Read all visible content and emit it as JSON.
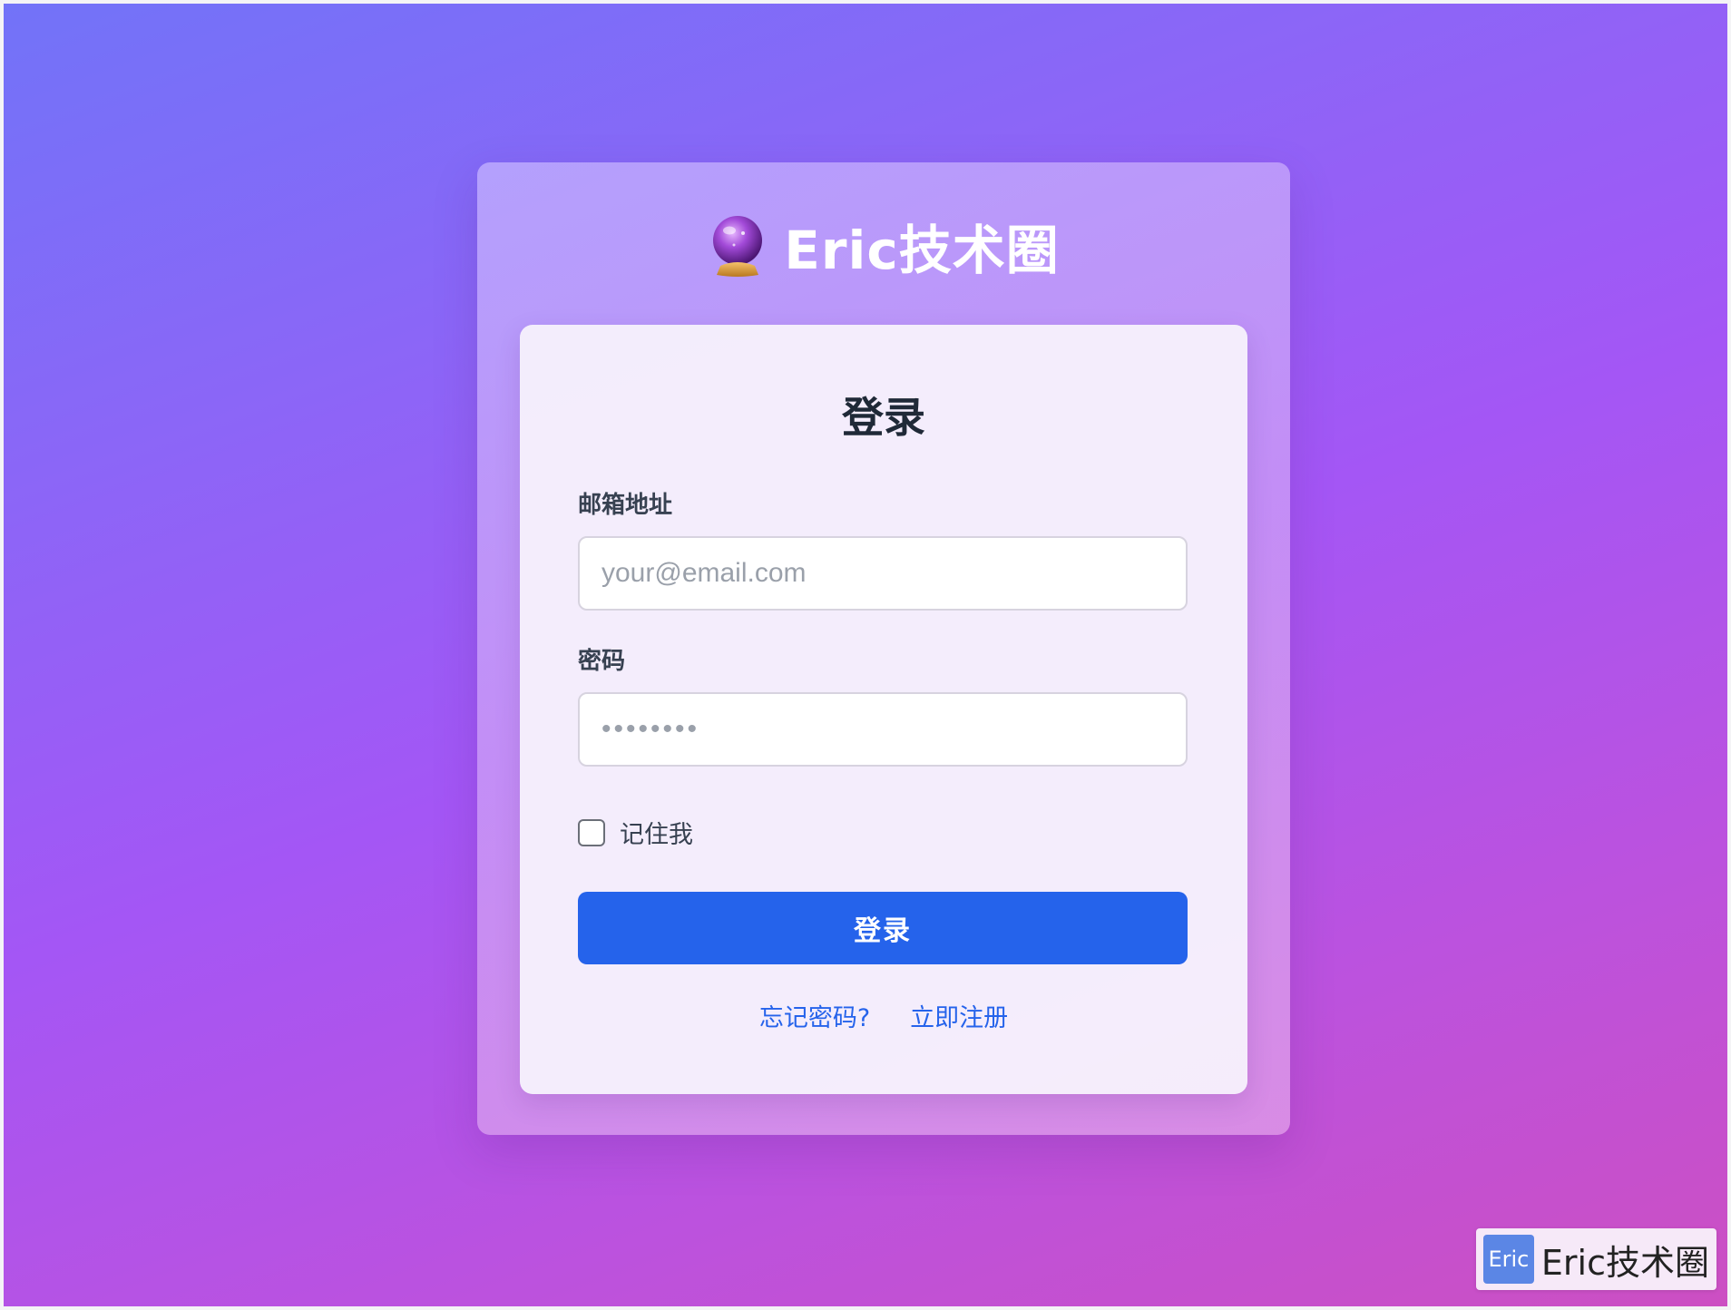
{
  "brand": {
    "title": "Eric技术圈",
    "icon": "crystal-ball-icon"
  },
  "form": {
    "heading": "登录",
    "email": {
      "label": "邮箱地址",
      "placeholder": "your@email.com",
      "value": ""
    },
    "password": {
      "label": "密码",
      "placeholder": "••••••••",
      "value": ""
    },
    "remember_label": "记住我",
    "remember_checked": false,
    "submit_label": "登录",
    "forgot_label": "忘记密码?",
    "register_label": "立即注册"
  },
  "watermark": {
    "logo_text": "Eric",
    "text": "Eric技术圈"
  },
  "colors": {
    "accent": "#2563eb",
    "gradient_start": "#7273f8",
    "gradient_end": "#cc4fc2"
  }
}
